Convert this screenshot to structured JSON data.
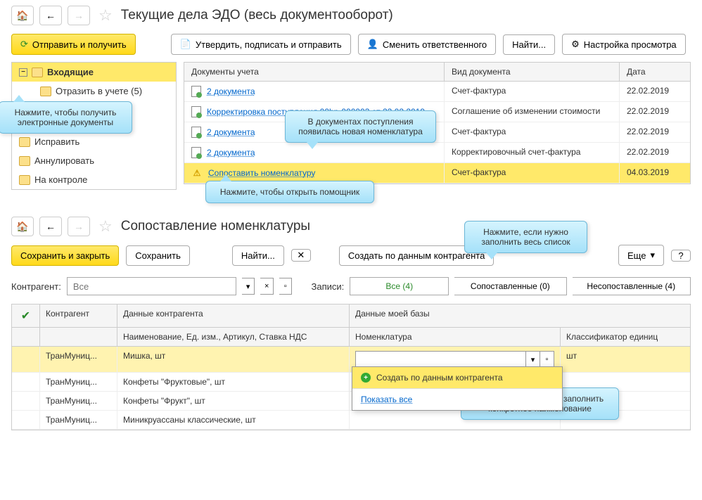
{
  "section1": {
    "title": "Текущие дела ЭДО (весь документооборот)",
    "send_receive_btn": "Отправить и получить",
    "approve_btn": "Утвердить, подписать и отправить",
    "change_resp_btn": "Сменить ответственного",
    "find_btn": "Найти...",
    "settings_btn": "Настройка просмотра",
    "sidebar": [
      {
        "label": "Входящие",
        "selected": true
      },
      {
        "label": "Отразить в учете (5)",
        "child": true
      },
      {
        "label": "Исправить"
      },
      {
        "label": "Аннулировать"
      },
      {
        "label": "На контроле"
      }
    ],
    "table_headers": {
      "col1": "Документы учета",
      "col2": "Вид документа",
      "col3": "Дата"
    },
    "rows": [
      {
        "doc": "2 документа",
        "type": "Счет-фактура",
        "date": "22.02.2019"
      },
      {
        "doc": "Корректировка поступления 00bp-000003 от 22.02.2019",
        "type": "Соглашение об изменении стоимости",
        "date": "22.02.2019"
      },
      {
        "doc": "2 документа",
        "type": "Счет-фактура",
        "date": "22.02.2019"
      },
      {
        "doc": "2 документа",
        "type": "Корректировочный счет-фактура",
        "date": "22.02.2019"
      },
      {
        "doc": "Сопоставить номенклатуру",
        "type": "Счет-фактура",
        "date": "04.03.2019",
        "warn": true,
        "highlighted": true
      }
    ],
    "balloon1": "Нажмите, чтобы получить электронные документы",
    "balloon2": "В документах поступления появилась новая номенклатура",
    "balloon3": "Нажмите, чтобы открыть помощник"
  },
  "section2": {
    "title": "Сопоставление номенклатуры",
    "save_close_btn": "Сохранить и закрыть",
    "save_btn": "Сохранить",
    "find_btn": "Найти...",
    "create_btn": "Создать по данным контрагента",
    "more_btn": "Еще",
    "balloon_top": "Нажмите, если нужно заполнить весь список",
    "filter_label": "Контрагент:",
    "filter_placeholder": "Все",
    "records_label": "Записи:",
    "seg1": "Все (4)",
    "seg2": "Сопоставленные (0)",
    "seg3": "Несопоставленные (4)",
    "headers": {
      "c1": "Контрагент",
      "c2": "Данные контрагента",
      "c3": "Данные моей базы",
      "c2b": "Наименование, Ед. изм., Артикул, Ставка НДС",
      "c3b": "Номенклатура",
      "c4b": "Классификатор единиц"
    },
    "rows": [
      {
        "agent": "ТранМуниц...",
        "data": "Мишка, шт",
        "unit": "шт",
        "highlighted": true
      },
      {
        "agent": "ТранМуниц...",
        "data": "Конфеты \"Фруктовые\", шт"
      },
      {
        "agent": "ТранМуниц...",
        "data": "Конфеты \"Фрукт\", шт"
      },
      {
        "agent": "ТранМуниц...",
        "data": "Миникруассаны классические, шт"
      }
    ],
    "dropdown": {
      "create": "Создать по данным контрагента",
      "show_all": "Показать все"
    },
    "balloon_dd": "Нажмите, если нужно заполнить конкретное наименование"
  }
}
